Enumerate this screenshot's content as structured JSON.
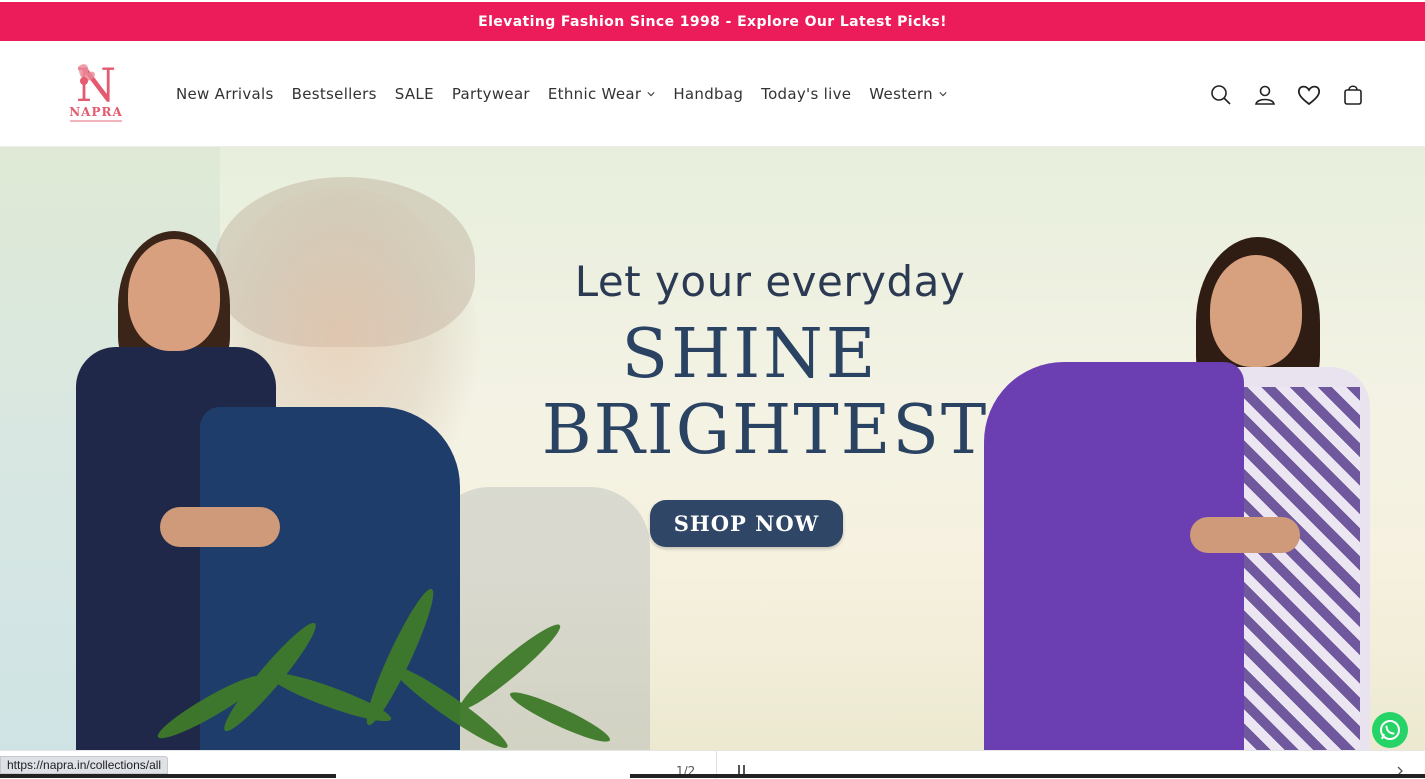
{
  "announcement": {
    "text": "Elevating Fashion Since 1998 - Explore Our Latest Picks!"
  },
  "brand": {
    "name": "NAPRA",
    "logo_letter": "N",
    "accent": "#ec1c5b"
  },
  "nav": {
    "items": [
      {
        "label": "New Arrivals",
        "has_dropdown": false
      },
      {
        "label": "Bestsellers",
        "has_dropdown": false
      },
      {
        "label": "SALE",
        "has_dropdown": false
      },
      {
        "label": "Partywear",
        "has_dropdown": false
      },
      {
        "label": "Ethnic Wear",
        "has_dropdown": true
      },
      {
        "label": "Handbag",
        "has_dropdown": false
      },
      {
        "label": "Today's live",
        "has_dropdown": false
      },
      {
        "label": "Western",
        "has_dropdown": true
      }
    ]
  },
  "header_icons": [
    "search-icon",
    "account-icon",
    "wishlist-heart-icon",
    "cart-icon"
  ],
  "hero": {
    "line1": "Let your everyday",
    "line2": "SHINE",
    "line3": "BRIGHTEST",
    "cta": "SHOP NOW",
    "cta_color": "#2f4666"
  },
  "slider": {
    "counter": "1/2"
  },
  "status_bar": {
    "url": "https://napra.in/collections/all"
  }
}
